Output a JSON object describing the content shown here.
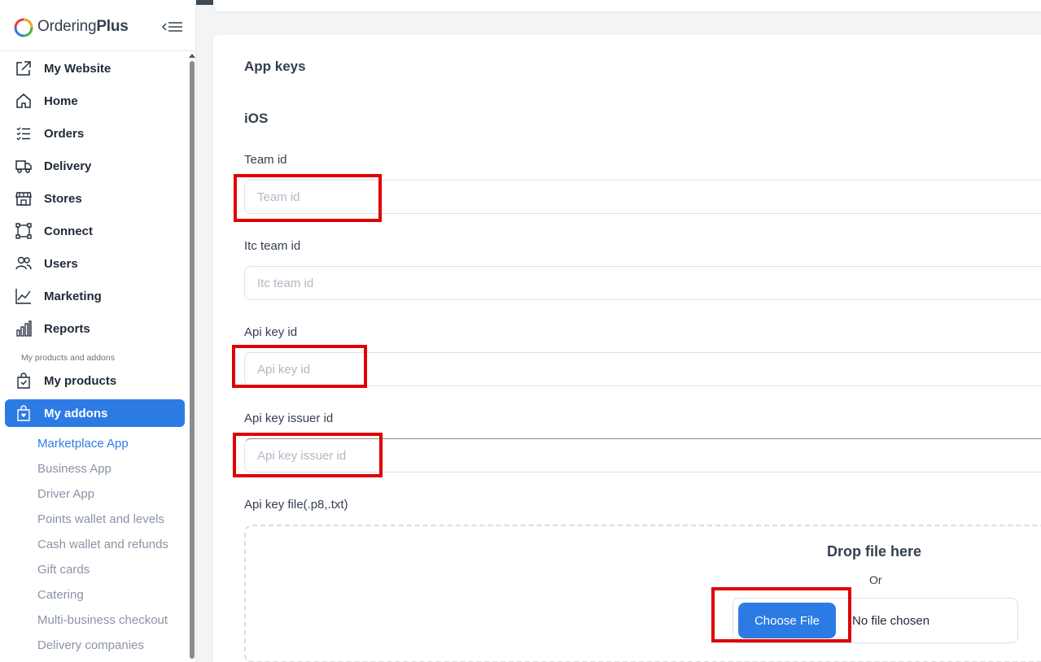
{
  "colors": {
    "accent": "#2c7be5",
    "highlight": "#e00000",
    "sidebar_bg": "#ffffff",
    "main_bg": "#f3f4f6"
  },
  "brand": {
    "name_regular": "Ordering",
    "name_bold": "Plus"
  },
  "sidebar": {
    "items": [
      {
        "label": "My Website",
        "icon": "external-link-icon"
      },
      {
        "label": "Home",
        "icon": "home-icon"
      },
      {
        "label": "Orders",
        "icon": "list-check-icon"
      },
      {
        "label": "Delivery",
        "icon": "truck-icon"
      },
      {
        "label": "Stores",
        "icon": "store-icon"
      },
      {
        "label": "Connect",
        "icon": "bounding-box-icon"
      },
      {
        "label": "Users",
        "icon": "people-icon"
      },
      {
        "label": "Marketing",
        "icon": "graph-up-icon"
      },
      {
        "label": "Reports",
        "icon": "bar-chart-icon"
      }
    ],
    "section_label": "My products and addons",
    "products_label": "My products",
    "addons_label": "My addons",
    "sub_items": [
      "Marketplace App",
      "Business App",
      "Driver App",
      "Points wallet and levels",
      "Cash wallet and refunds",
      "Gift cards",
      "Catering",
      "Multi-business checkout",
      "Delivery companies"
    ]
  },
  "main": {
    "title": "App keys",
    "section": "iOS",
    "fields": [
      {
        "label": "Team id",
        "placeholder": "Team id",
        "value": ""
      },
      {
        "label": "Itc team id",
        "placeholder": "Itc team id",
        "value": ""
      },
      {
        "label": "Api key id",
        "placeholder": "Api key id",
        "value": ""
      },
      {
        "label": "Api key issuer id",
        "placeholder": "Api key issuer id",
        "value": ""
      }
    ],
    "file_field": {
      "label": "Api key file(.p8,.txt)",
      "drop_title": "Drop file here",
      "or": "Or",
      "button_label": "Choose File",
      "no_file": "No file chosen"
    }
  }
}
